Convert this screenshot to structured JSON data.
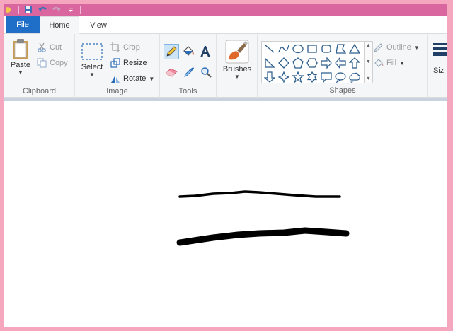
{
  "tabs": {
    "file": "File",
    "home": "Home",
    "view": "View"
  },
  "clipboard": {
    "label": "Clipboard",
    "paste": "Paste",
    "cut": "Cut",
    "copy": "Copy"
  },
  "image": {
    "label": "Image",
    "select": "Select",
    "crop": "Crop",
    "resize": "Resize",
    "rotate": "Rotate"
  },
  "tools": {
    "label": "Tools"
  },
  "brushes": {
    "label": "Brushes"
  },
  "shapes": {
    "label": "Shapes",
    "outline": "Outline",
    "fill": "Fill"
  },
  "size": {
    "label": "Siz"
  },
  "colors": {
    "titlebar": "#d9669f",
    "frame": "#f6a7c0",
    "file_tab": "#1f6fc9",
    "icon_blue": "#2b6cb8",
    "brush_orange": "#e0692a"
  },
  "icons": {
    "qat": [
      "app-icon",
      "save-icon",
      "undo-icon",
      "redo-icon",
      "customize-dropdown-icon"
    ],
    "tools": [
      "pencil-icon",
      "fill-bucket-icon",
      "text-icon",
      "eraser-icon",
      "color-picker-icon",
      "magnifier-icon"
    ]
  }
}
